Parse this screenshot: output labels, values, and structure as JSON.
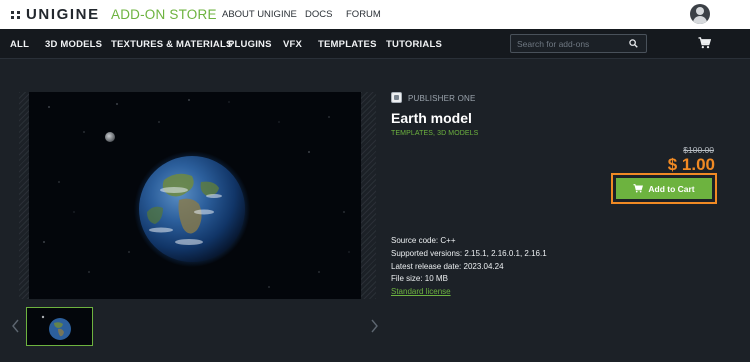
{
  "header": {
    "logo_text": "UNIGINE",
    "store_title": "ADD-ON STORE",
    "links": [
      "ABOUT UNIGINE",
      "DOCS",
      "FORUM"
    ],
    "avatar_icon": "user-avatar-icon"
  },
  "nav": {
    "categories": [
      "ALL",
      "3D MODELS",
      "TEXTURES & MATERIALS",
      "PLUGINS",
      "VFX",
      "TEMPLATES",
      "TUTORIALS"
    ],
    "search_placeholder": "Search for add-ons",
    "search_icon": "search-icon",
    "cart_icon": "cart-icon"
  },
  "product": {
    "publisher": "PUBLISHER ONE",
    "title": "Earth model",
    "categories": "TEMPLATES, 3D MODELS",
    "old_price": "$100.00",
    "price": "$ 1.00",
    "add_to_cart": "Add to Cart",
    "specs": {
      "source_code": "Source code: C++",
      "versions": "Supported versions: 2.15.1, 2.16.0.1, 2.16.1",
      "release_date": "Latest release date: 2023.04.24",
      "file_size": "File size: 10 MB"
    },
    "license": "Standard license"
  },
  "colors": {
    "accent_green": "#6db33f",
    "price_orange": "#f08a24",
    "page_bg": "#1c2127",
    "nav_bg": "#15191e"
  }
}
